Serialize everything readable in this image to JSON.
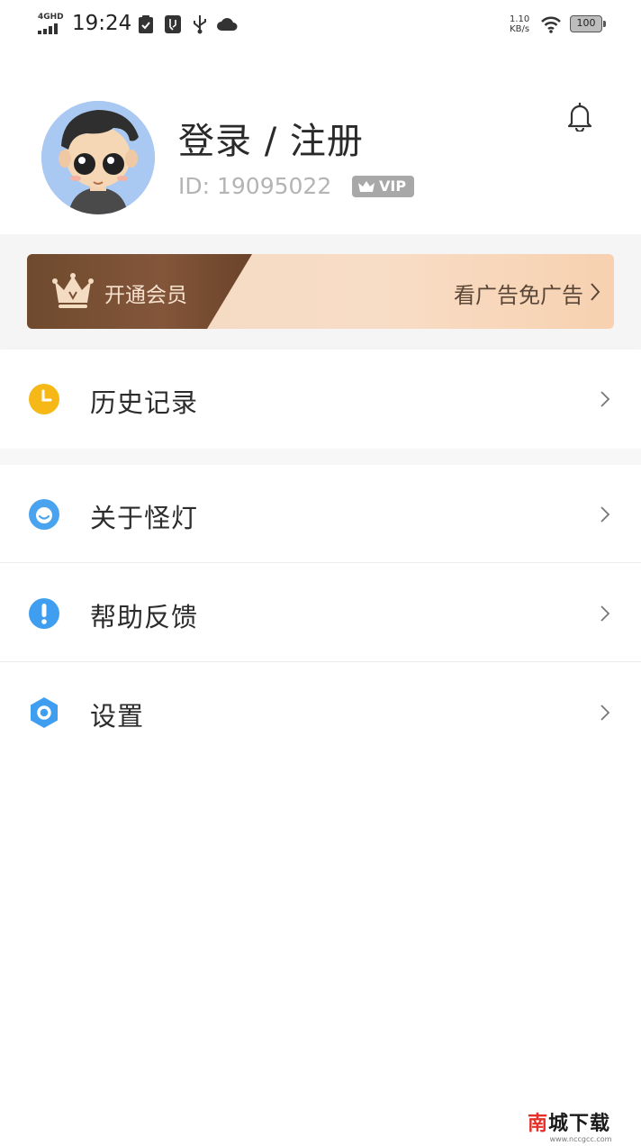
{
  "status_bar": {
    "network": "4GHD",
    "time": "19:24",
    "speed_value": "1.10",
    "speed_unit": "KB/s",
    "battery": "100",
    "icons": [
      "signal-icon",
      "clipboard-check-icon",
      "usb-debug-icon",
      "usb-icon",
      "cloud-icon",
      "wifi-icon",
      "battery-icon"
    ]
  },
  "profile": {
    "title": "登录 / 注册",
    "id_text": "ID: 19095022",
    "vip_label": "VIP"
  },
  "member_banner": {
    "label": "开通会员",
    "cta": "看广告免广告"
  },
  "menu": {
    "history": {
      "label": "历史记录",
      "icon": "clock-icon",
      "color": "#f5b817"
    },
    "about": {
      "label": "关于怪灯",
      "icon": "smile-icon",
      "color": "#4aa3ee"
    },
    "help": {
      "label": "帮助反馈",
      "icon": "exclamation-icon",
      "color": "#3f9ef0"
    },
    "settings": {
      "label": "设置",
      "icon": "hexagon-settings-icon",
      "color": "#3f9ef0"
    }
  },
  "watermark": {
    "brand_red": "南",
    "brand_rest": "城下载",
    "url": "www.nccgcc.com"
  },
  "colors": {
    "banner_dark": "#7a4f33",
    "banner_light": "#f7d8bf",
    "vip_badge": "#a8a8a8"
  }
}
